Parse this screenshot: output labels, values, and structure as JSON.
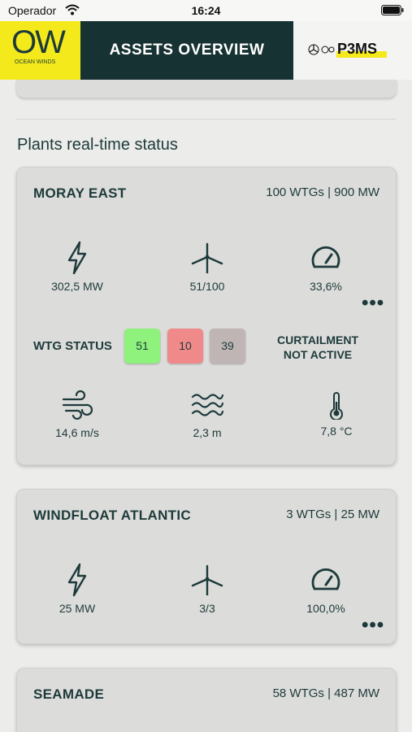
{
  "status_bar": {
    "carrier": "Operador",
    "time": "16:24"
  },
  "header": {
    "logo_letters": "OW",
    "logo_subtitle": "OCEAN WINDS",
    "title": "ASSETS OVERVIEW",
    "partner_logo": "P3MS"
  },
  "section_title": "Plants real-time status",
  "plants": [
    {
      "name": "MORAY EAST",
      "capacity": "100 WTGs | 900 MW",
      "power": "302,5 MW",
      "turbines": "51/100",
      "load_factor": "33,6%",
      "more": "•••",
      "wtg_status_label": "WTG STATUS",
      "wtg_status": [
        "51",
        "10",
        "39"
      ],
      "curtailment_line1": "CURTAILMENT",
      "curtailment_line2": "NOT ACTIVE",
      "wind_speed": "14,6 m/s",
      "wave_height": "2,3 m",
      "temperature": "7,8 °C"
    },
    {
      "name": "WINDFLOAT ATLANTIC",
      "capacity": "3 WTGs | 25 MW",
      "power": "25 MW",
      "turbines": "3/3",
      "load_factor": "100,0%",
      "more": "•••"
    },
    {
      "name": "SEAMADE",
      "capacity": "58 WTGs | 487 MW"
    }
  ],
  "colors": {
    "accent_yellow": "#f4ea1b",
    "header_dark": "#173232",
    "status_ok": "#8ef27c",
    "status_fault": "#f08a8a",
    "status_other": "#bfb5b5"
  },
  "icons": [
    "wifi-icon",
    "battery-icon",
    "bolt-icon",
    "turbine-icon",
    "gauge-icon",
    "wind-icon",
    "waves-icon",
    "thermometer-icon",
    "more-icon"
  ]
}
